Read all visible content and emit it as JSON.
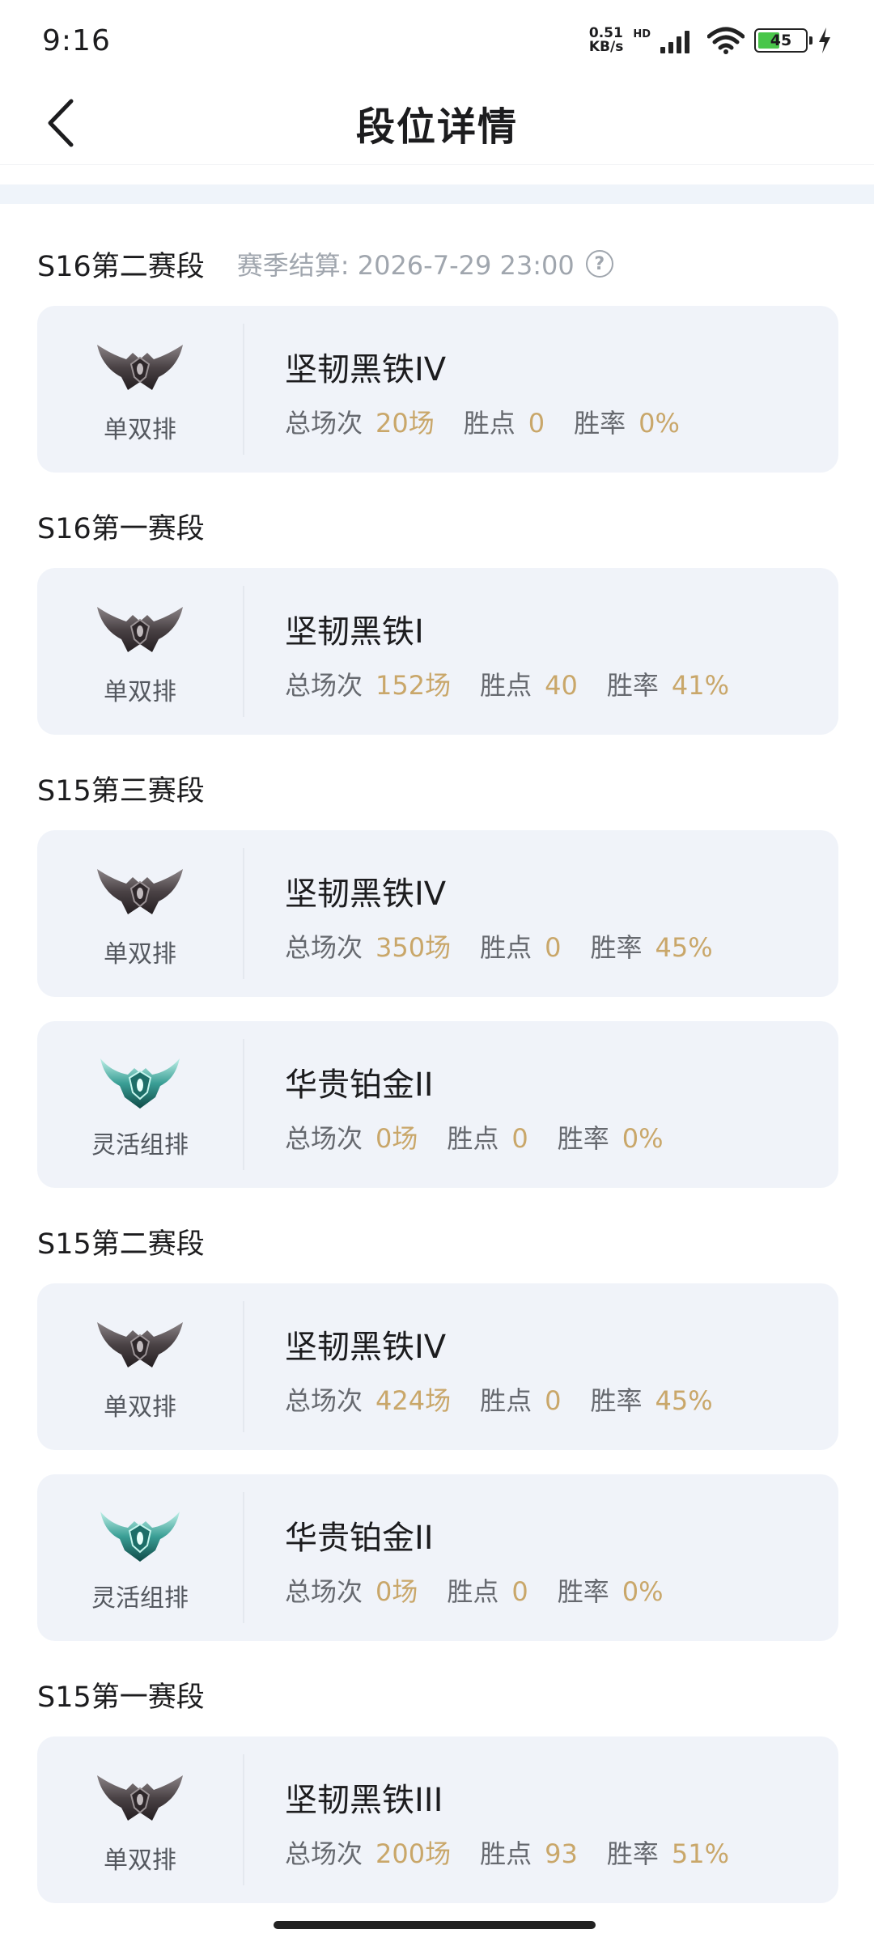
{
  "status_bar": {
    "time": "9:16",
    "net_speed_value": "0.51",
    "net_speed_unit": "KB/s",
    "hd_label": "HD",
    "battery_level": "45"
  },
  "nav": {
    "title": "段位详情",
    "back_icon": "chevron-left-icon"
  },
  "sections": [
    {
      "title": "S16第二赛段",
      "settlement": "赛季结算: 2026-7-29 23:00",
      "help_icon": "?"
    },
    {
      "title": "S16第一赛段"
    },
    {
      "title": "S15第三赛段"
    },
    {
      "title": "S15第二赛段"
    },
    {
      "title": "S15第一赛段"
    }
  ],
  "stat_labels": {
    "games": "总场次",
    "points": "胜点",
    "winrate": "胜率"
  },
  "cards": [
    {
      "queue": "单双排",
      "emblem": "iron-emblem-icon",
      "rank": "坚韧黑铁IV",
      "games": "20场",
      "points": "0",
      "winrate": "0%"
    },
    {
      "queue": "单双排",
      "emblem": "iron-emblem-icon",
      "rank": "坚韧黑铁I",
      "games": "152场",
      "points": "40",
      "winrate": "41%"
    },
    {
      "queue": "单双排",
      "emblem": "iron-emblem-icon",
      "rank": "坚韧黑铁IV",
      "games": "350场",
      "points": "0",
      "winrate": "45%"
    },
    {
      "queue": "灵活组排",
      "emblem": "platinum-emblem-icon",
      "rank": "华贵铂金II",
      "games": "0场",
      "points": "0",
      "winrate": "0%"
    },
    {
      "queue": "单双排",
      "emblem": "iron-emblem-icon",
      "rank": "坚韧黑铁IV",
      "games": "424场",
      "points": "0",
      "winrate": "45%"
    },
    {
      "queue": "灵活组排",
      "emblem": "platinum-emblem-icon",
      "rank": "华贵铂金II",
      "games": "0场",
      "points": "0",
      "winrate": "0%"
    },
    {
      "queue": "单双排",
      "emblem": "iron-emblem-icon",
      "rank": "坚韧黑铁III",
      "games": "200场",
      "points": "93",
      "winrate": "51%"
    }
  ],
  "colors": {
    "accent_gold": "#c9a76a",
    "card_background": "#f0f3f9",
    "muted_text": "#a0a6ae"
  }
}
